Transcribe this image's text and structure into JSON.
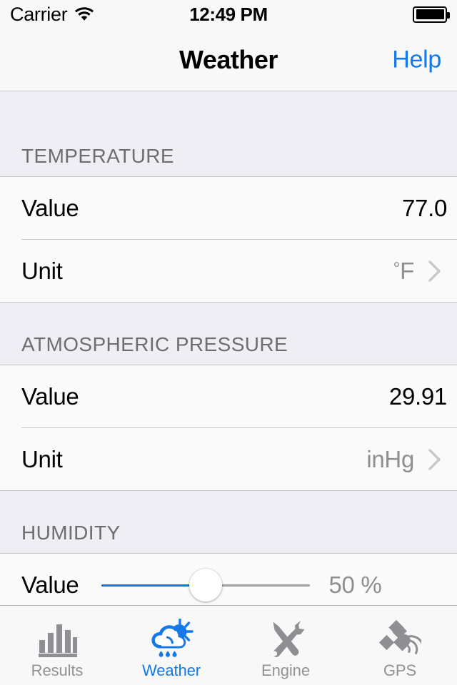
{
  "status_bar": {
    "carrier": "Carrier",
    "wifi_icon": "wifi-icon",
    "time": "12:49 PM",
    "battery_icon": "battery-full-icon"
  },
  "nav_bar": {
    "title": "Weather",
    "action_label": "Help"
  },
  "colors": {
    "accent_blue": "#1578e8",
    "slider_fill": "#0b76e0",
    "slider_track": "#a0a0a4",
    "muted_text": "#8e8e93",
    "section_header_bg": "#eeeef4",
    "cell_bg": "#fafafa"
  },
  "sections": [
    {
      "header": "TEMPERATURE",
      "rows": [
        {
          "label": "Value",
          "value": "77.0",
          "type": "value",
          "chevron": false
        },
        {
          "label": "Unit",
          "value": "°F",
          "type": "disclosure",
          "chevron": true
        }
      ]
    },
    {
      "header": "ATMOSPHERIC PRESSURE",
      "rows": [
        {
          "label": "Value",
          "value": "29.91",
          "type": "value",
          "chevron": false
        },
        {
          "label": "Unit",
          "value": "inHg",
          "type": "disclosure",
          "chevron": true
        }
      ]
    },
    {
      "header": "HUMIDITY",
      "rows": [
        {
          "label": "Value",
          "value": "50 %",
          "type": "slider",
          "slider_percent": 50,
          "slider_min": 0,
          "slider_max": 100
        }
      ]
    }
  ],
  "tab_bar": {
    "items": [
      {
        "label": "Results",
        "icon": "bar-chart-icon",
        "active": false
      },
      {
        "label": "Weather",
        "icon": "cloud-sun-rain-icon",
        "active": true
      },
      {
        "label": "Engine",
        "icon": "wrench-screwdriver-icon",
        "active": false
      },
      {
        "label": "GPS",
        "icon": "satellite-icon",
        "active": false
      }
    ]
  }
}
